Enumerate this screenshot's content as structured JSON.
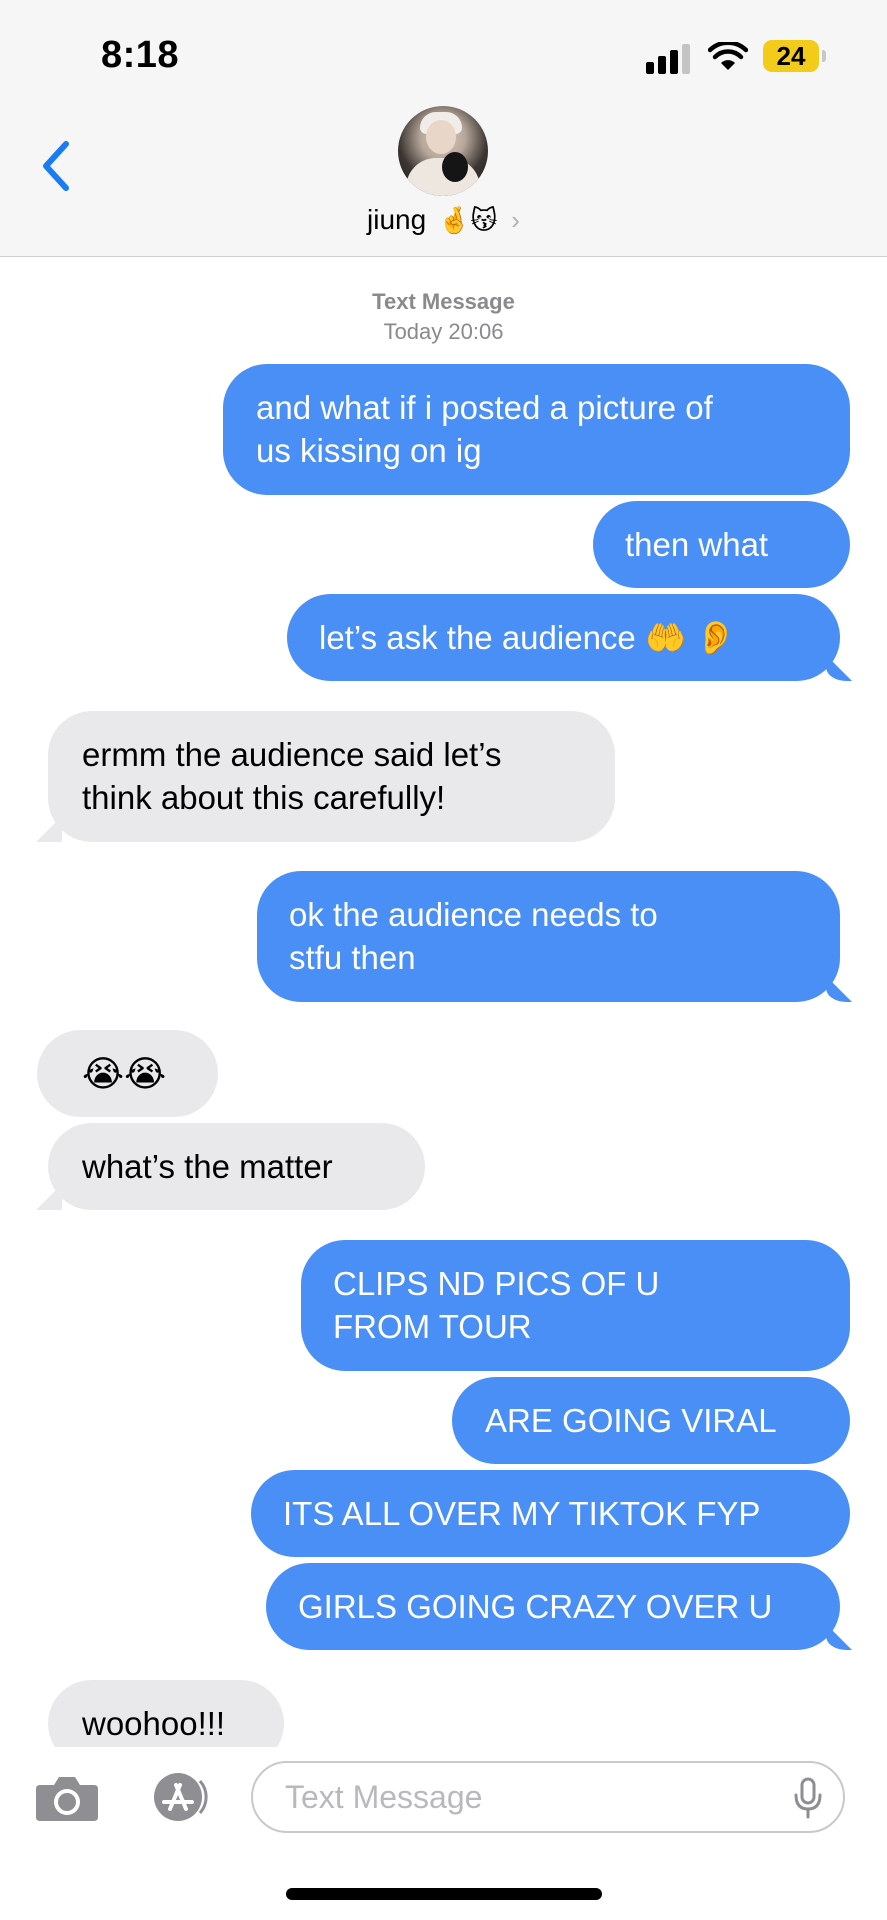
{
  "status_bar": {
    "time": "8:18",
    "battery_level": "24",
    "signal_bars_filled": 3,
    "signal_bars_total": 4
  },
  "header": {
    "contact_name": "jiung",
    "contact_emoji": "🤞😽",
    "chevron": "›",
    "back_icon": "chevron-left-icon"
  },
  "conversation": {
    "service_label": "Text Message",
    "timestamp": "Today 20:06",
    "messages": [
      {
        "from": "me",
        "lines": [
          "and what if i posted a picture of",
          "us kissing on ig"
        ]
      },
      {
        "from": "me",
        "lines": [
          "then what"
        ]
      },
      {
        "from": "me",
        "lines": [
          "let’s ask the audience 🤲 👂"
        ]
      },
      {
        "from": "them",
        "lines": [
          "ermm the audience said let’s",
          "think about this carefully!"
        ]
      },
      {
        "from": "me",
        "lines": [
          "ok the audience needs to",
          "stfu then"
        ]
      },
      {
        "from": "them",
        "lines": [
          "😭😭"
        ]
      },
      {
        "from": "them",
        "lines": [
          "what’s the matter"
        ]
      },
      {
        "from": "me",
        "lines": [
          "CLIPS ND PICS OF U",
          "FROM TOUR"
        ]
      },
      {
        "from": "me",
        "lines": [
          "ARE GOING VIRAL"
        ]
      },
      {
        "from": "me",
        "lines": [
          "ITS ALL OVER MY TIKTOK FYP"
        ]
      },
      {
        "from": "me",
        "lines": [
          "GIRLS GOING CRAZY OVER U"
        ]
      },
      {
        "from": "them",
        "lines": [
          "woohoo!!!"
        ]
      }
    ]
  },
  "input_bar": {
    "placeholder": "Text Message",
    "left_icons": [
      "camera-icon",
      "app-store-icon"
    ],
    "right_icon": "microphone-icon"
  },
  "colors": {
    "sent_bubble": "#4a8ff5",
    "received_bubble": "#e9e9eb",
    "ios_blue": "#1a7cf5",
    "battery": "#f2cb1b"
  }
}
